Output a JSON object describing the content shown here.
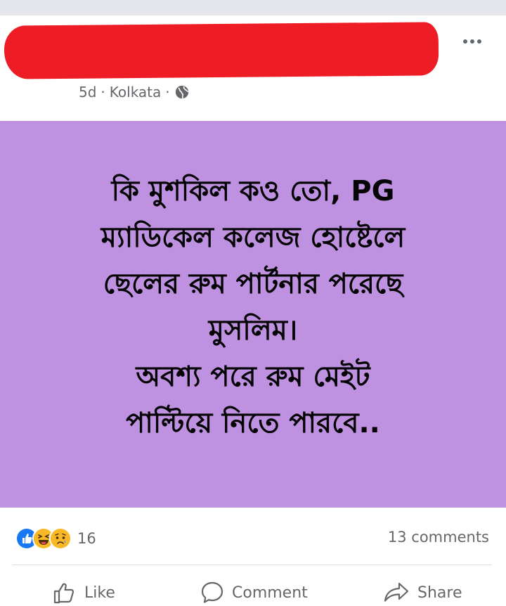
{
  "post": {
    "meta": {
      "time": "5d",
      "location": "Kolkata",
      "sep": "·",
      "privacy_icon": "globe-icon"
    },
    "more_icon": "more-horizontal-icon",
    "text_lines": "কি মুশকিল কও তো, PG\nম্যাডিকেল কলেজ হোষ্টেলে\nছেলের রুম পার্টনার পরেছে\nমুসলিম।\nঅবশ্য পরে রুম মেইট\nপাল্টিয়ে নিতে পারবে..",
    "background_color": "#bf91e1"
  },
  "stats": {
    "reaction_icons": [
      "like-reaction-icon",
      "haha-reaction-icon",
      "sad-reaction-icon"
    ],
    "reaction_count": "16",
    "comments": "13 comments"
  },
  "actions": {
    "like": "Like",
    "comment": "Comment",
    "share": "Share"
  },
  "colors": {
    "redaction": "#ee1c25",
    "like_blue": "#1877f2",
    "emoji_yellow": "#f7b928"
  }
}
